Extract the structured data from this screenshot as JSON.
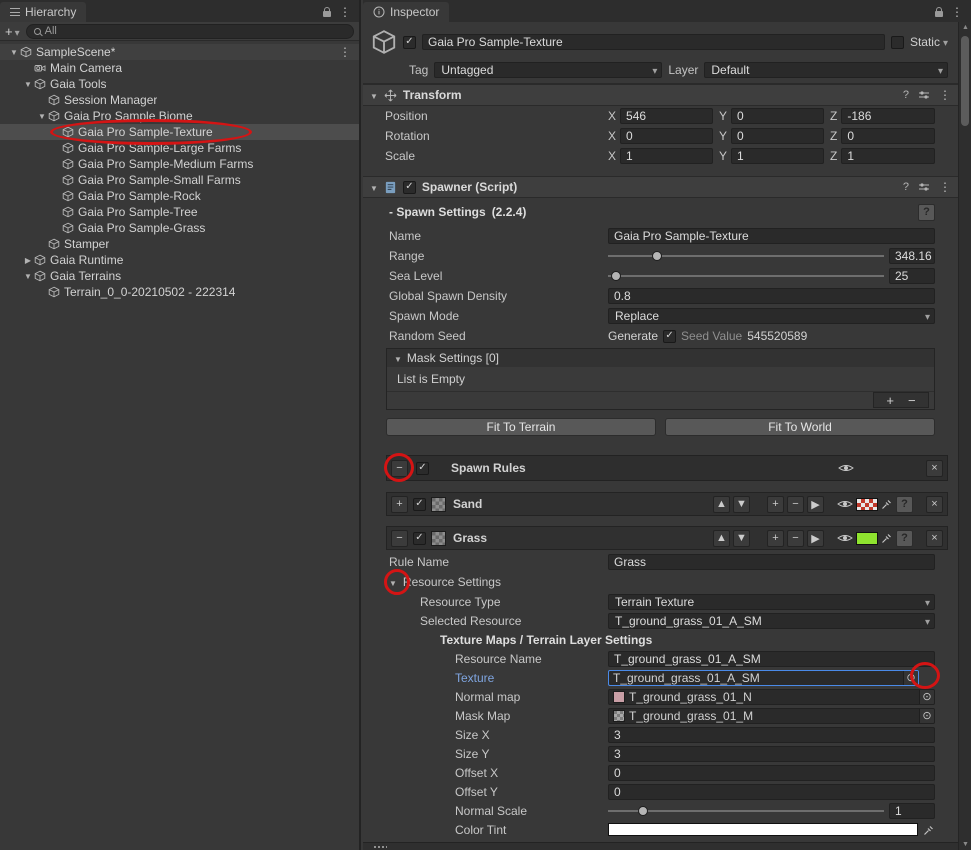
{
  "colors": {
    "accent_blue": "#4a8ae8",
    "selection_gray": "#4d4d4d",
    "annotation_red": "#d41414",
    "sand_swatch": "#c0392b",
    "grass_swatch": "#8fe32f"
  },
  "hierarchy": {
    "tab_label": "Hierarchy",
    "create_button": "+",
    "search_value": "All",
    "items": [
      {
        "label": "SampleScene*"
      },
      {
        "label": "Main Camera"
      },
      {
        "label": "Gaia Tools"
      },
      {
        "label": "Session Manager"
      },
      {
        "label": "Gaia Pro Sample Biome"
      },
      {
        "label": "Gaia Pro Sample-Texture"
      },
      {
        "label": "Gaia Pro Sample-Large Farms"
      },
      {
        "label": "Gaia Pro Sample-Medium Farms"
      },
      {
        "label": "Gaia Pro Sample-Small Farms"
      },
      {
        "label": "Gaia Pro Sample-Rock"
      },
      {
        "label": "Gaia Pro Sample-Tree"
      },
      {
        "label": "Gaia Pro Sample-Grass"
      },
      {
        "label": "Stamper"
      },
      {
        "label": "Gaia Runtime"
      },
      {
        "label": "Gaia Terrains"
      },
      {
        "label": "Terrain_0_0-20210502 - 222314"
      }
    ]
  },
  "inspector": {
    "tab_label": "Inspector",
    "header": {
      "name": "Gaia Pro Sample-Texture",
      "static_label": "Static",
      "tag_label": "Tag",
      "tag_value": "Untagged",
      "layer_label": "Layer",
      "layer_value": "Default"
    },
    "transform": {
      "title": "Transform",
      "axis_x": "X",
      "axis_y": "Y",
      "axis_z": "Z",
      "rows": [
        {
          "label": "Position",
          "x": "546",
          "y": "0",
          "z": "-186"
        },
        {
          "label": "Rotation",
          "x": "0",
          "y": "0",
          "z": "0"
        },
        {
          "label": "Scale",
          "x": "1",
          "y": "1",
          "z": "1"
        }
      ]
    },
    "spawner": {
      "title": "Spawner (Script)",
      "settings_title": "- Spawn Settings",
      "settings_version": "(2.2.4)",
      "name_label": "Name",
      "name_value": "Gaia Pro Sample-Texture",
      "range_label": "Range",
      "range_value": "348.16",
      "sea_level_label": "Sea Level",
      "sea_level_value": "25",
      "density_label": "Global Spawn Density",
      "density_value": "0.8",
      "spawn_mode_label": "Spawn Mode",
      "spawn_mode_value": "Replace",
      "random_seed_label": "Random Seed",
      "generate_label": "Generate",
      "seed_value_label": "Seed Value",
      "seed_value": "545520589",
      "mask_settings_header": "Mask Settings [0]",
      "mask_empty_text": "List is Empty",
      "fit_terrain_button": "Fit To Terrain",
      "fit_world_button": "Fit To World"
    },
    "spawn_rules": {
      "title": "Spawn Rules",
      "rules": [
        {
          "name": "Sand"
        },
        {
          "name": "Grass"
        }
      ],
      "grass": {
        "rule_name_label": "Rule Name",
        "rule_name_value": "Grass",
        "resource_settings_label": "Resource Settings",
        "resource_type_label": "Resource Type",
        "resource_type_value": "Terrain Texture",
        "selected_resource_label": "Selected Resource",
        "selected_resource_value": "T_ground_grass_01_A_SM",
        "texture_maps_header": "Texture Maps / Terrain Layer Settings",
        "resource_name_label": "Resource Name",
        "resource_name_value": "T_ground_grass_01_A_SM",
        "texture_label": "Texture",
        "texture_value": "T_ground_grass_01_A_SM",
        "normal_map_label": "Normal map",
        "normal_map_value": "T_ground_grass_01_N",
        "mask_map_label": "Mask Map",
        "mask_map_value": "T_ground_grass_01_M",
        "size_x_label": "Size X",
        "size_x_value": "3",
        "size_y_label": "Size Y",
        "size_y_value": "3",
        "offset_x_label": "Offset X",
        "offset_x_value": "0",
        "offset_y_label": "Offset Y",
        "offset_y_value": "0",
        "normal_scale_label": "Normal Scale",
        "normal_scale_value": "1",
        "color_tint_label": "Color Tint"
      }
    }
  }
}
